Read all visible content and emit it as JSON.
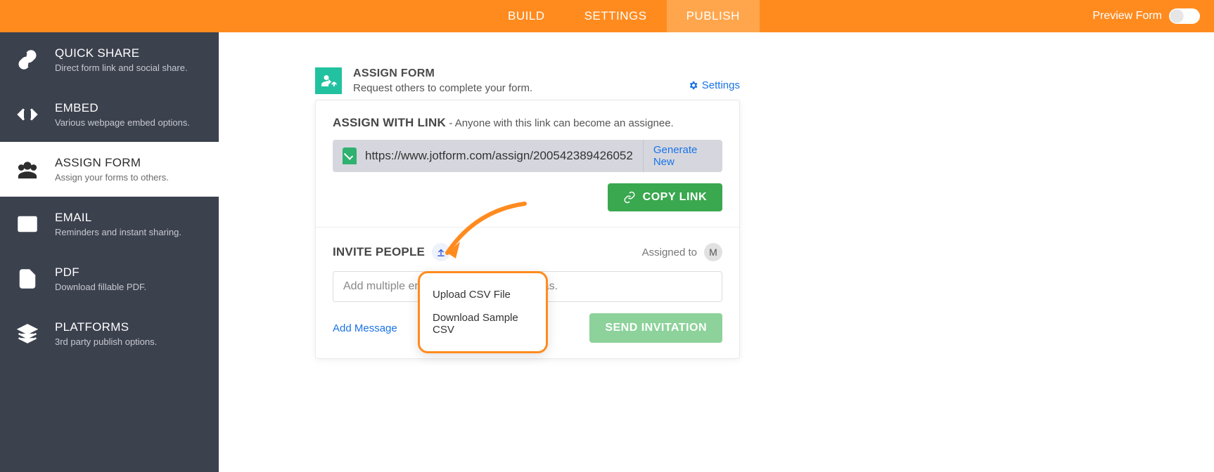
{
  "topnav": {
    "tabs": [
      "BUILD",
      "SETTINGS",
      "PUBLISH"
    ],
    "preview_label": "Preview Form"
  },
  "sidebar": {
    "items": [
      {
        "title": "QUICK SHARE",
        "sub": "Direct form link and social share."
      },
      {
        "title": "EMBED",
        "sub": "Various webpage embed options."
      },
      {
        "title": "ASSIGN FORM",
        "sub": "Assign your forms to others."
      },
      {
        "title": "EMAIL",
        "sub": "Reminders and instant sharing."
      },
      {
        "title": "PDF",
        "sub": "Download fillable PDF."
      },
      {
        "title": "PLATFORMS",
        "sub": "3rd party publish options."
      }
    ]
  },
  "page": {
    "title": "ASSIGN FORM",
    "sub": "Request others to complete your form.",
    "settings_label": "Settings"
  },
  "assign_link": {
    "title": "ASSIGN WITH LINK",
    "desc": "- Anyone with this link can become an assignee.",
    "url": "https://www.jotform.com/assign/200542389426052",
    "generate_label": "Generate New",
    "copy_label": "COPY LINK"
  },
  "invite": {
    "title": "INVITE PEOPLE",
    "assigned_label": "Assigned to",
    "avatar_initial": "M",
    "placeholder": "Add multiple emails separated by commas.",
    "add_message_label": "Add Message",
    "send_label": "SEND INVITATION"
  },
  "popup": {
    "upload_label": "Upload CSV File",
    "download_label": "Download Sample CSV"
  }
}
